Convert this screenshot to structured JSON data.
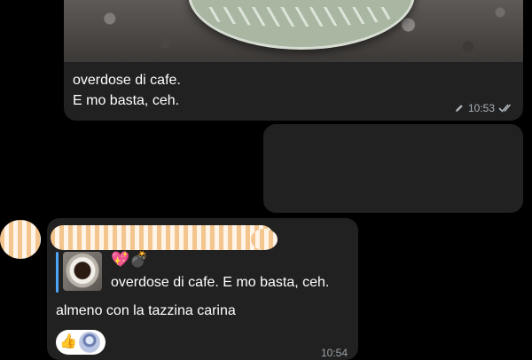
{
  "outgoing_photo_message": {
    "caption_lines": [
      "overdose di cafe.",
      "E mo basta, ceh."
    ],
    "time": "10:53",
    "edited_icon": "pencil-icon",
    "status_icon": "double-check-icon"
  },
  "incoming_message": {
    "reply": {
      "emoji": "💖💣",
      "text": "overdose di cafe. E mo basta, ceh."
    },
    "text": "almeno con la tazzina carina",
    "reaction": {
      "emoji": "👍"
    },
    "time": "10:54"
  },
  "colors": {
    "background": "#000000",
    "bubble": "#212121",
    "reply_accent": "#4ea4f6",
    "meta_text": "#aab2b8"
  }
}
